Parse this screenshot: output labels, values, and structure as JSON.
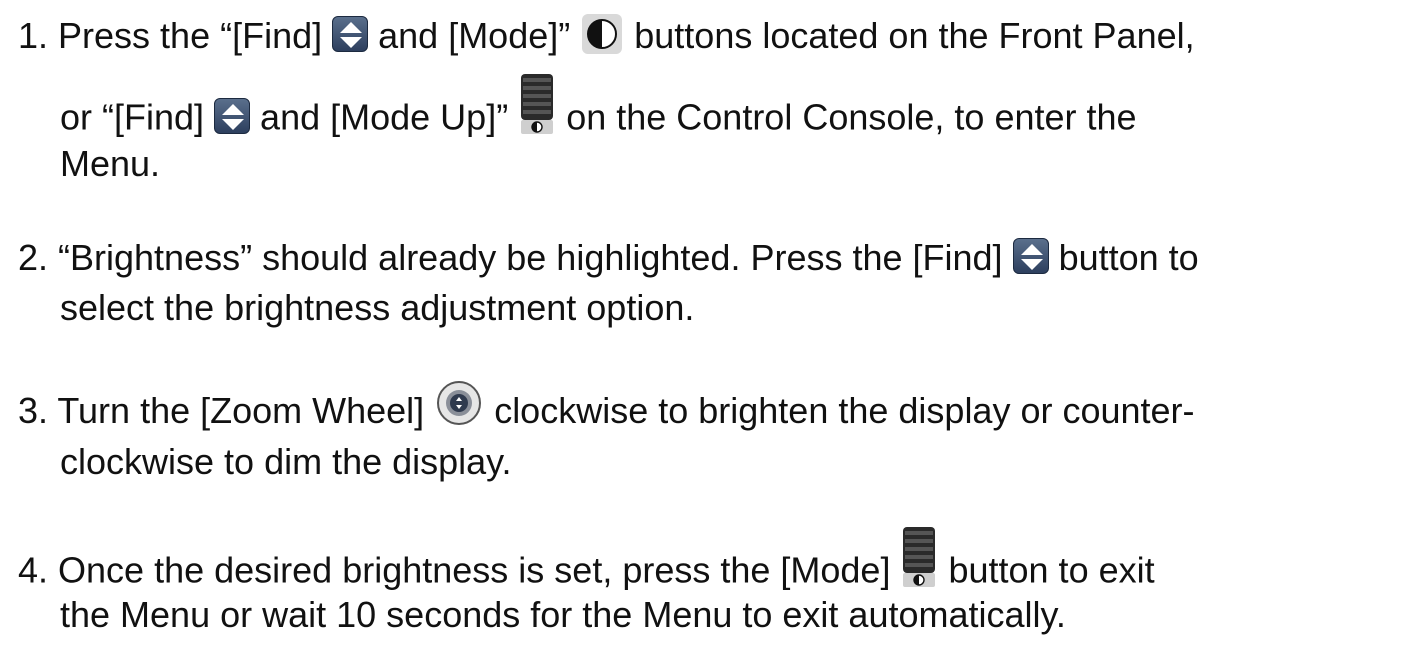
{
  "steps": [
    {
      "line1": {
        "a": "1. Press the “[Find]",
        "b": "and [Mode]”",
        "c": "buttons located on the Front Panel,"
      },
      "line2": {
        "a": "or “[Find]",
        "b": "and [Mode Up]”",
        "c": "on the Control Console, to enter the"
      },
      "line3": "Menu."
    },
    {
      "line1": {
        "a": "2. “Brightness” should already be highlighted. Press the [Find]",
        "b": "button to"
      },
      "line2": "select the brightness adjustment option."
    },
    {
      "line1": {
        "a": "3. Turn the [Zoom Wheel]",
        "b": "clockwise to brighten the display or counter-"
      },
      "line2": "clockwise to dim the display."
    },
    {
      "line1": {
        "a": "4. Once the desired brightness is set, press the [Mode]",
        "b": "button to exit"
      },
      "line2": "the Menu or wait 10 seconds for the Menu to exit automatically."
    }
  ],
  "icons": {
    "find": "find-updown-icon",
    "mode": "mode-contrast-icon",
    "mode_up": "mode-up-lever-icon",
    "zoom_wheel": "zoom-wheel-icon"
  },
  "colors": {
    "text": "#111111",
    "find_icon": "#3b4f6e",
    "mode_icon_bg": "#d9d9d9"
  }
}
